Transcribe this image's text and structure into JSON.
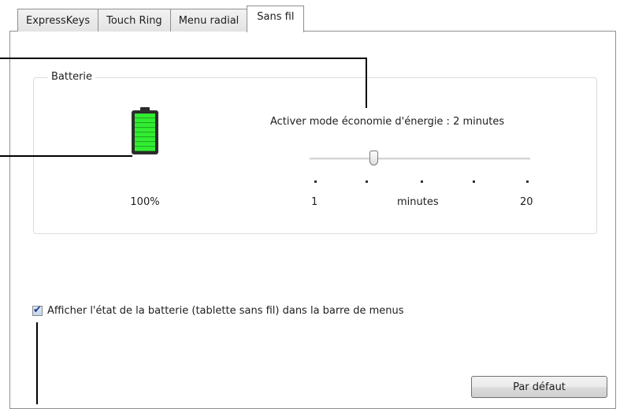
{
  "tabs": [
    {
      "label": "ExpressKeys",
      "active": false
    },
    {
      "label": "Touch Ring",
      "active": false
    },
    {
      "label": "Menu radial",
      "active": false
    },
    {
      "label": "Sans fil",
      "active": true
    }
  ],
  "battery_group": {
    "title": "Batterie",
    "level_percent": 100,
    "level_text": "100%"
  },
  "power_saving": {
    "label": "Activer mode économie d'énergie : 2 minutes",
    "slider_min": 1,
    "slider_max": 20,
    "slider_value": 2,
    "min_label": "1",
    "unit_label": "minutes",
    "max_label": "20"
  },
  "battery_menu_checkbox": {
    "label": "Afficher l'état de la batterie (tablette sans fil) dans la barre de menus",
    "checked": true
  },
  "buttons": {
    "default_label": "Par défaut"
  },
  "colors": {
    "battery_fill": "#34f034",
    "checkmark": "#1d3a8e"
  },
  "icons": {
    "battery": "battery-icon",
    "checkmark": "check-mark-icon"
  }
}
